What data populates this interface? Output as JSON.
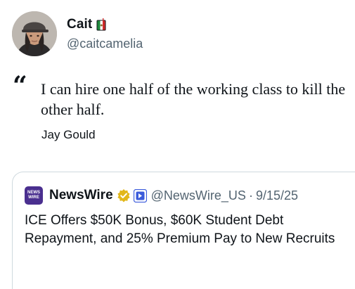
{
  "author": {
    "display_name": "Cait",
    "handle": "@caitcamelia",
    "name_emoji": "mexico-flag-juice-box-icon"
  },
  "quote": {
    "mark": "“",
    "text": "I can hire one half of the working class to kill the other half.",
    "attribution": "Jay Gould"
  },
  "quoted_post": {
    "logo_text_top": "NEWS",
    "logo_text_bottom": "WIRE",
    "display_name": "NewsWire",
    "handle": "@NewsWire_US",
    "separator": "·",
    "date": "9/15/25",
    "verified_badge": "gold-verified-badge-icon",
    "affiliate_badge": "affiliate-logo-icon",
    "text": "ICE Offers $50K Bonus, $60K Student Debt Repayment, and 25% Premium Pay to New Recruits"
  },
  "colors": {
    "text_primary": "#0f1419",
    "text_secondary": "#536471",
    "border": "#cfd9de",
    "verified_gold": "#e2b719",
    "affiliate_blue": "#3b5bdb",
    "newswire_purple": "#4a2f8f"
  }
}
